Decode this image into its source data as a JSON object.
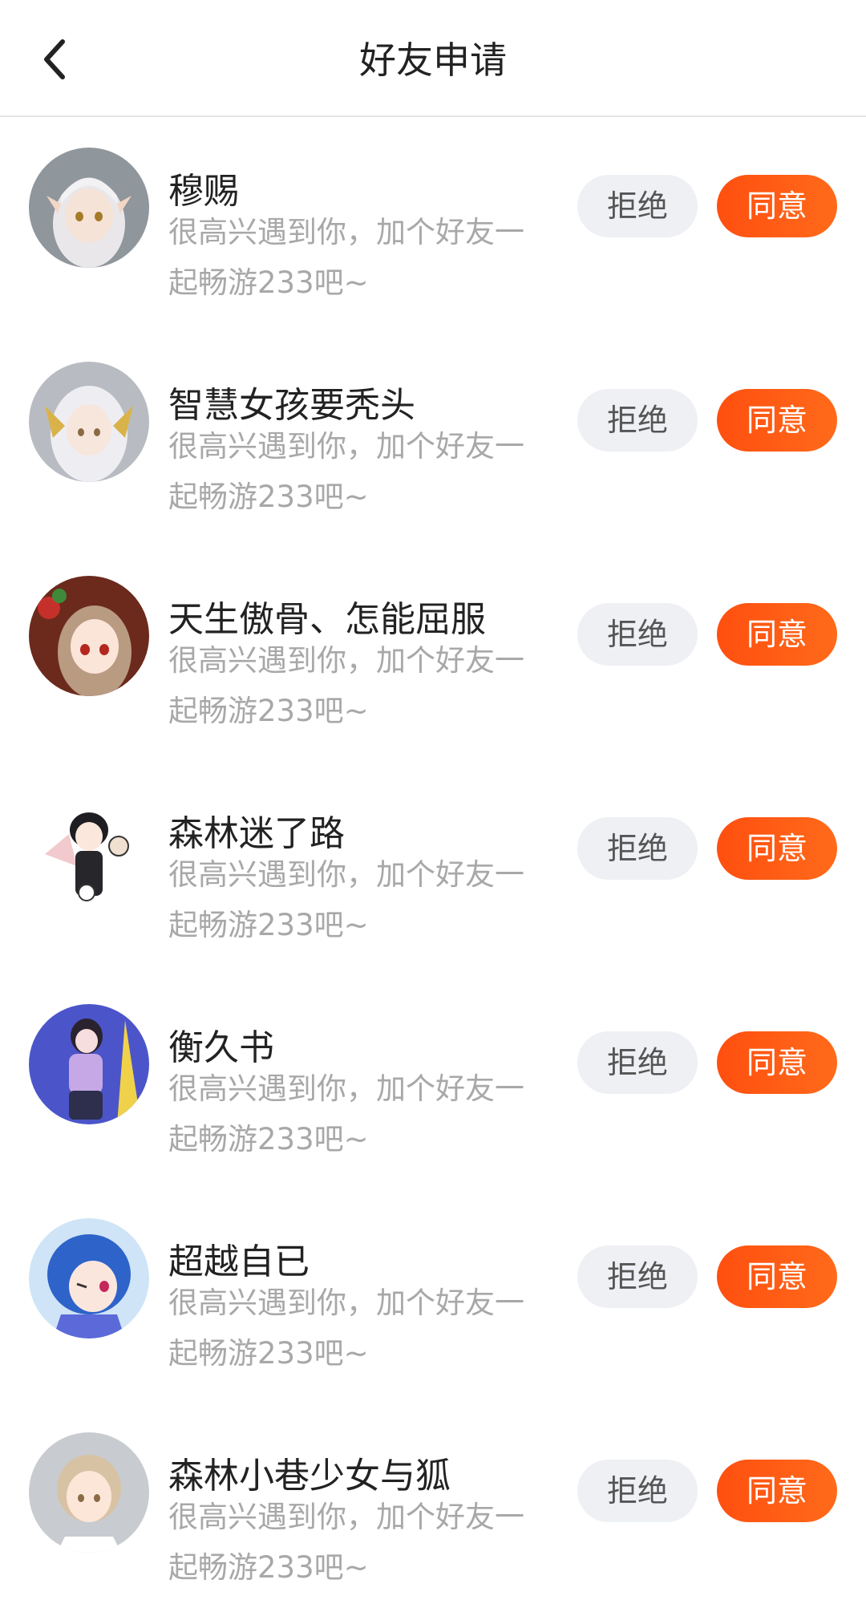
{
  "header": {
    "title": "好友申请",
    "back_icon": "back-arrow-icon"
  },
  "colors": {
    "accent": "#FF5A12",
    "reject_bg": "#EEF0F4",
    "message_text": "#A8A8A8"
  },
  "requests": [
    {
      "name": "穆赐",
      "message": "很高兴遇到你，加个好友一起畅游233吧~",
      "reject_label": "拒绝",
      "accept_label": "同意"
    },
    {
      "name": "智慧女孩要秃头",
      "message": "很高兴遇到你，加个好友一起畅游233吧~",
      "reject_label": "拒绝",
      "accept_label": "同意"
    },
    {
      "name": "天生傲骨、怎能屈服",
      "message": "很高兴遇到你，加个好友一起畅游233吧~",
      "reject_label": "拒绝",
      "accept_label": "同意"
    },
    {
      "name": "森林迷了路",
      "message": "很高兴遇到你，加个好友一起畅游233吧~",
      "reject_label": "拒绝",
      "accept_label": "同意"
    },
    {
      "name": "衡久书",
      "message": "很高兴遇到你，加个好友一起畅游233吧~",
      "reject_label": "拒绝",
      "accept_label": "同意"
    },
    {
      "name": "超越自已",
      "message": "很高兴遇到你，加个好友一起畅游233吧~",
      "reject_label": "拒绝",
      "accept_label": "同意"
    },
    {
      "name": "森林小巷少女与狐",
      "message": "很高兴遇到你，加个好友一起畅游233吧~",
      "reject_label": "拒绝",
      "accept_label": "同意"
    }
  ]
}
